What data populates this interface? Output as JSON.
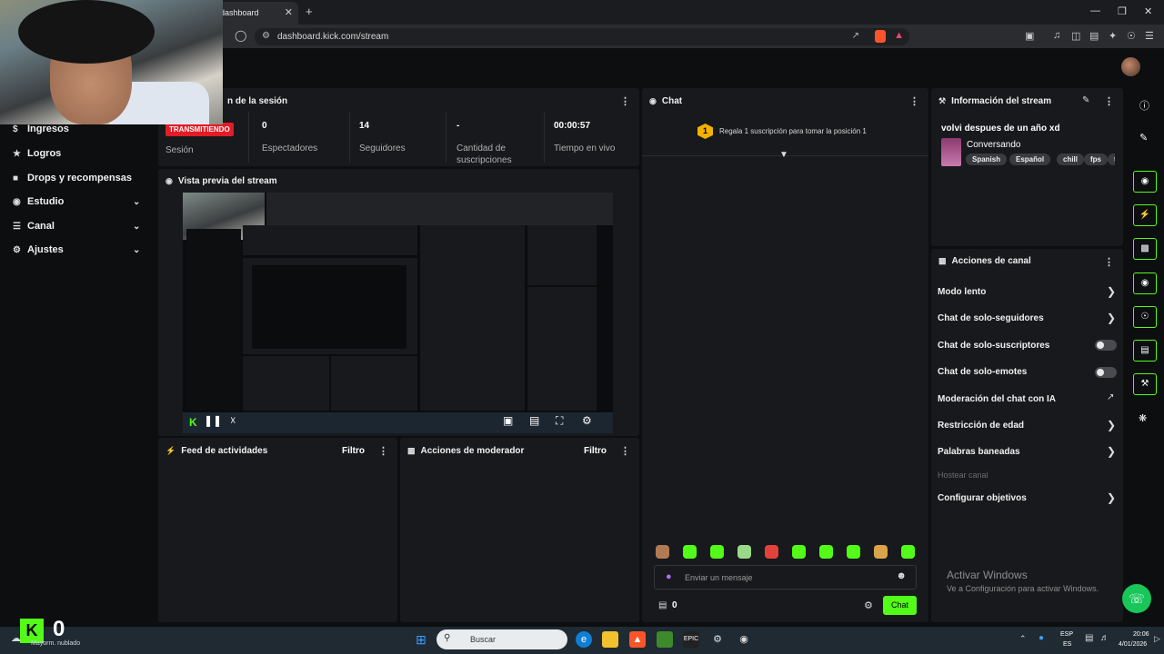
{
  "browser": {
    "tab_title": "dashboard",
    "url": "dashboard.kick.com/stream",
    "new_tab": "+",
    "tab_close": "✕"
  },
  "sidebar": {
    "items": [
      {
        "label": "Ingresos",
        "icon": "dollar-icon"
      },
      {
        "label": "Logros",
        "icon": "trophy-icon"
      },
      {
        "label": "Drops y recompensas",
        "icon": "gift-icon"
      },
      {
        "label": "Estudio",
        "icon": "studio-icon",
        "expandable": true
      },
      {
        "label": "Canal",
        "icon": "channel-icon",
        "expandable": true
      },
      {
        "label": "Ajustes",
        "icon": "gear-icon",
        "expandable": true
      }
    ]
  },
  "session": {
    "title": "n de la sesión",
    "status_badge": "TRANSMITIENDO",
    "status_label": "Sesión",
    "stats": [
      {
        "value": "0",
        "label": "Espectadores"
      },
      {
        "value": "14",
        "label": "Seguidores"
      },
      {
        "value": "-",
        "label": "Cantidad de suscripciones"
      },
      {
        "value": "00:00:57",
        "label": "Tiempo en vivo"
      }
    ]
  },
  "preview": {
    "title": "Vista previa del stream"
  },
  "activity": {
    "title": "Feed de actividades",
    "filter": "Filtro"
  },
  "moderator": {
    "title": "Acciones de moderador",
    "filter": "Filtro"
  },
  "chat": {
    "title": "Chat",
    "gift_rank": "1",
    "gift_text": "Regala 1 suscripción para tomar la posición 1",
    "placeholder": "Enviar un mensaje",
    "points": "0",
    "send_label": "Chat"
  },
  "stream_info": {
    "title": "Información del stream",
    "stream_title": "volvi despues de un año xd",
    "category": "Conversando",
    "tags": [
      "Spanish",
      "Español",
      "chill",
      "fps",
      "t"
    ]
  },
  "channel_actions": {
    "title": "Acciones de canal",
    "items": [
      {
        "label": "Modo lento",
        "control": "chevron"
      },
      {
        "label": "Chat de solo-seguidores",
        "control": "chevron"
      },
      {
        "label": "Chat de solo-suscriptores",
        "control": "toggle",
        "on": false
      },
      {
        "label": "Chat de solo-emotes",
        "control": "toggle",
        "on": false
      },
      {
        "label": "Moderación del chat con IA",
        "control": "external"
      },
      {
        "label": "Restricción de edad",
        "control": "chevron"
      },
      {
        "label": "Palabras baneadas",
        "control": "chevron"
      },
      {
        "label": "Hostear canal",
        "control": "none",
        "disabled": true
      },
      {
        "label": "Configurar objetivos",
        "control": "chevron"
      }
    ]
  },
  "watermark": {
    "line1": "Activar Windows",
    "line2": "Ve a Configuración para activar Windows."
  },
  "overlay": {
    "counter": "0",
    "weather": "Mayorm. nublado"
  },
  "taskbar": {
    "search_placeholder": "Buscar",
    "lang_top": "ESP",
    "lang_bottom": "ES",
    "time": "20:06",
    "date": "4/01/2026"
  },
  "colors": {
    "accent": "#53fc18",
    "live": "#e31c25",
    "panel": "#18191c",
    "background": "#0d0e10"
  }
}
